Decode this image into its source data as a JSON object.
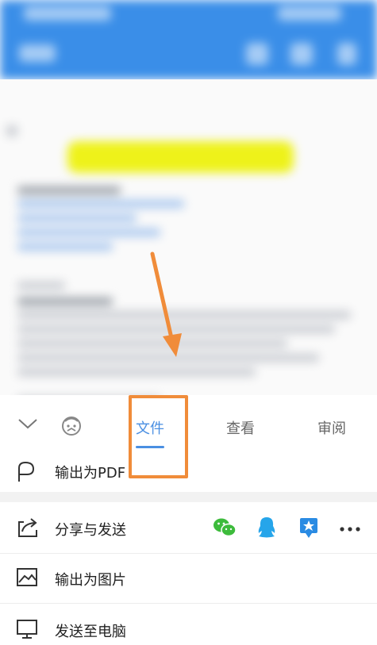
{
  "toolbar": {
    "tabs": [
      {
        "label": "文件",
        "active": true
      },
      {
        "label": "查看",
        "active": false
      },
      {
        "label": "审阅",
        "active": false
      }
    ]
  },
  "menu": {
    "export_pdf": "输出为PDF",
    "share_send": "分享与发送",
    "export_image": "输出为图片",
    "send_to_pc": "发送至电脑"
  },
  "share_targets": [
    "wechat-icon",
    "qq-icon",
    "qzone-icon",
    "more-icon"
  ],
  "colors": {
    "accent": "#4a8fe2",
    "annotation": "#f08c3a",
    "highlight": "#eef21a",
    "topbar": "#3a8ee8"
  }
}
